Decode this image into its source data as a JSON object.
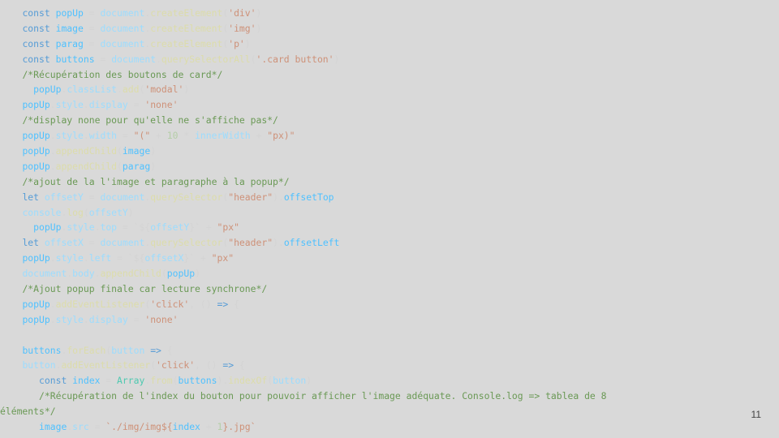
{
  "slide": {
    "page_number": "11"
  },
  "code_lines": [
    {
      "indent": "    ",
      "tokens": [
        {
          "t": "const ",
          "c": "kw"
        },
        {
          "t": "popUp",
          "c": "var"
        },
        {
          "t": " = ",
          "c": "op"
        },
        {
          "t": "document",
          "c": "prop"
        },
        {
          "t": ".",
          "c": "op"
        },
        {
          "t": "createElement",
          "c": "fn"
        },
        {
          "t": "(",
          "c": "op"
        },
        {
          "t": "'div'",
          "c": "str"
        },
        {
          "t": ")",
          "c": "op"
        }
      ]
    },
    {
      "indent": "    ",
      "tokens": [
        {
          "t": "const ",
          "c": "kw"
        },
        {
          "t": "image",
          "c": "var"
        },
        {
          "t": " = ",
          "c": "op"
        },
        {
          "t": "document",
          "c": "prop"
        },
        {
          "t": ".",
          "c": "op"
        },
        {
          "t": "createElement",
          "c": "fn"
        },
        {
          "t": "(",
          "c": "op"
        },
        {
          "t": "'img'",
          "c": "str"
        },
        {
          "t": ")",
          "c": "op"
        }
      ]
    },
    {
      "indent": "    ",
      "tokens": [
        {
          "t": "const ",
          "c": "kw"
        },
        {
          "t": "parag",
          "c": "var"
        },
        {
          "t": " = ",
          "c": "op"
        },
        {
          "t": "document",
          "c": "prop"
        },
        {
          "t": ".",
          "c": "op"
        },
        {
          "t": "createElement",
          "c": "fn"
        },
        {
          "t": "(",
          "c": "op"
        },
        {
          "t": "'p'",
          "c": "str"
        },
        {
          "t": ")",
          "c": "op"
        }
      ]
    },
    {
      "indent": "    ",
      "tokens": [
        {
          "t": "const ",
          "c": "kw"
        },
        {
          "t": "buttons",
          "c": "var"
        },
        {
          "t": " = ",
          "c": "op"
        },
        {
          "t": "document",
          "c": "prop"
        },
        {
          "t": ".",
          "c": "op"
        },
        {
          "t": "querySelectorAll",
          "c": "fn"
        },
        {
          "t": "(",
          "c": "op"
        },
        {
          "t": "'.card button'",
          "c": "str"
        },
        {
          "t": ")",
          "c": "op"
        }
      ]
    },
    {
      "indent": "    ",
      "tokens": [
        {
          "t": "/*Récupération des boutons de card*/",
          "c": "cm"
        }
      ]
    },
    {
      "indent": "      ",
      "tokens": [
        {
          "t": "popUp",
          "c": "var"
        },
        {
          "t": ".",
          "c": "op"
        },
        {
          "t": "classList",
          "c": "prop"
        },
        {
          "t": ".",
          "c": "op"
        },
        {
          "t": "add",
          "c": "fn"
        },
        {
          "t": "(",
          "c": "op"
        },
        {
          "t": "'modal'",
          "c": "str"
        },
        {
          "t": ")",
          "c": "op"
        }
      ]
    },
    {
      "indent": "    ",
      "tokens": [
        {
          "t": "popUp",
          "c": "var"
        },
        {
          "t": ".",
          "c": "op"
        },
        {
          "t": "style",
          "c": "prop"
        },
        {
          "t": ".",
          "c": "op"
        },
        {
          "t": "display",
          "c": "prop"
        },
        {
          "t": " = ",
          "c": "op"
        },
        {
          "t": "'none'",
          "c": "str"
        }
      ]
    },
    {
      "indent": "    ",
      "tokens": [
        {
          "t": "/*display none pour qu'elle ne s'affiche pas*/",
          "c": "cm"
        }
      ]
    },
    {
      "indent": "    ",
      "tokens": [
        {
          "t": "popUp",
          "c": "var"
        },
        {
          "t": ".",
          "c": "op"
        },
        {
          "t": "style",
          "c": "prop"
        },
        {
          "t": ".",
          "c": "op"
        },
        {
          "t": "width",
          "c": "prop"
        },
        {
          "t": " = ",
          "c": "op"
        },
        {
          "t": "\"(\"",
          "c": "str"
        },
        {
          "t": " + ",
          "c": "op"
        },
        {
          "t": "10",
          "c": "num"
        },
        {
          "t": " * ",
          "c": "op"
        },
        {
          "t": "innerWidth",
          "c": "prop"
        },
        {
          "t": " + ",
          "c": "op"
        },
        {
          "t": "\"px)\"",
          "c": "str"
        }
      ]
    },
    {
      "indent": "    ",
      "tokens": [
        {
          "t": "popUp",
          "c": "var"
        },
        {
          "t": ".",
          "c": "op"
        },
        {
          "t": "appendChild",
          "c": "fn"
        },
        {
          "t": "(",
          "c": "op"
        },
        {
          "t": "image",
          "c": "var"
        },
        {
          "t": ")",
          "c": "op"
        }
      ]
    },
    {
      "indent": "    ",
      "tokens": [
        {
          "t": "popUp",
          "c": "var"
        },
        {
          "t": ".",
          "c": "op"
        },
        {
          "t": "appendChild",
          "c": "fn"
        },
        {
          "t": "(",
          "c": "op"
        },
        {
          "t": "parag",
          "c": "var"
        },
        {
          "t": ")",
          "c": "op"
        }
      ]
    },
    {
      "indent": "    ",
      "tokens": [
        {
          "t": "/*ajout de la l'image et paragraphe à la popup*/",
          "c": "cm"
        }
      ]
    },
    {
      "indent": "    ",
      "tokens": [
        {
          "t": "let ",
          "c": "kw"
        },
        {
          "t": "offsetY",
          "c": "prop"
        },
        {
          "t": " = ",
          "c": "op"
        },
        {
          "t": "document",
          "c": "prop"
        },
        {
          "t": ".",
          "c": "op"
        },
        {
          "t": "querySelector",
          "c": "fn"
        },
        {
          "t": "(",
          "c": "op"
        },
        {
          "t": "\"header\"",
          "c": "str"
        },
        {
          "t": ").",
          "c": "op"
        },
        {
          "t": "offsetTop",
          "c": "var"
        }
      ]
    },
    {
      "indent": "    ",
      "tokens": [
        {
          "t": "console",
          "c": "prop"
        },
        {
          "t": ".",
          "c": "op"
        },
        {
          "t": "log",
          "c": "fn"
        },
        {
          "t": "(",
          "c": "op"
        },
        {
          "t": "offsetY",
          "c": "prop"
        },
        {
          "t": ")",
          "c": "op"
        }
      ]
    },
    {
      "indent": "      ",
      "tokens": [
        {
          "t": "popUp",
          "c": "var"
        },
        {
          "t": ".",
          "c": "op"
        },
        {
          "t": "style",
          "c": "prop"
        },
        {
          "t": ".",
          "c": "op"
        },
        {
          "t": "top",
          "c": "prop"
        },
        {
          "t": " = ",
          "c": "op"
        },
        {
          "t": "`${",
          "c": "tpl"
        },
        {
          "t": "offsetY",
          "c": "prop"
        },
        {
          "t": "}`",
          "c": "tpl"
        },
        {
          "t": " + ",
          "c": "op"
        },
        {
          "t": "\"px\"",
          "c": "str"
        }
      ]
    },
    {
      "indent": "    ",
      "tokens": [
        {
          "t": "let ",
          "c": "kw"
        },
        {
          "t": "offsetX",
          "c": "prop"
        },
        {
          "t": " = ",
          "c": "op"
        },
        {
          "t": "document",
          "c": "prop"
        },
        {
          "t": ".",
          "c": "op"
        },
        {
          "t": "querySelector",
          "c": "fn"
        },
        {
          "t": "(",
          "c": "op"
        },
        {
          "t": "\"header\"",
          "c": "str"
        },
        {
          "t": ").",
          "c": "op"
        },
        {
          "t": "offsetLeft",
          "c": "var"
        }
      ]
    },
    {
      "indent": "    ",
      "tokens": [
        {
          "t": "popUp",
          "c": "var"
        },
        {
          "t": ".",
          "c": "op"
        },
        {
          "t": "style",
          "c": "prop"
        },
        {
          "t": ".",
          "c": "op"
        },
        {
          "t": "left",
          "c": "prop"
        },
        {
          "t": " = ",
          "c": "op"
        },
        {
          "t": "`${",
          "c": "tpl"
        },
        {
          "t": "offsetX",
          "c": "prop"
        },
        {
          "t": "}`",
          "c": "tpl"
        },
        {
          "t": " + ",
          "c": "op"
        },
        {
          "t": "\"px\"",
          "c": "str"
        }
      ]
    },
    {
      "indent": "    ",
      "tokens": [
        {
          "t": "document",
          "c": "prop"
        },
        {
          "t": ".",
          "c": "op"
        },
        {
          "t": "body",
          "c": "prop"
        },
        {
          "t": ".",
          "c": "op"
        },
        {
          "t": "appendChild",
          "c": "fn"
        },
        {
          "t": "(",
          "c": "op"
        },
        {
          "t": "popUp",
          "c": "var"
        },
        {
          "t": ")",
          "c": "op"
        }
      ]
    },
    {
      "indent": "    ",
      "tokens": [
        {
          "t": "/*Ajout popup finale car lecture synchrone*/",
          "c": "cm"
        }
      ]
    },
    {
      "indent": "    ",
      "tokens": [
        {
          "t": "popUp",
          "c": "var"
        },
        {
          "t": ".",
          "c": "op"
        },
        {
          "t": "addEventListener",
          "c": "fn"
        },
        {
          "t": "(",
          "c": "op"
        },
        {
          "t": "'click'",
          "c": "str"
        },
        {
          "t": ", () ",
          "c": "op"
        },
        {
          "t": "=>",
          "c": "kw"
        },
        {
          "t": " {",
          "c": "op"
        }
      ]
    },
    {
      "indent": "    ",
      "tokens": [
        {
          "t": "popUp",
          "c": "var"
        },
        {
          "t": ".",
          "c": "op"
        },
        {
          "t": "style",
          "c": "prop"
        },
        {
          "t": ".",
          "c": "op"
        },
        {
          "t": "display",
          "c": "prop"
        },
        {
          "t": " = ",
          "c": "op"
        },
        {
          "t": "'none'",
          "c": "str"
        }
      ]
    },
    {
      "indent": "",
      "tokens": []
    },
    {
      "indent": "    ",
      "tokens": [
        {
          "t": "buttons",
          "c": "var"
        },
        {
          "t": ".",
          "c": "op"
        },
        {
          "t": "forEach",
          "c": "fn"
        },
        {
          "t": "(",
          "c": "op"
        },
        {
          "t": "button",
          "c": "prop"
        },
        {
          "t": " ",
          "c": "op"
        },
        {
          "t": "=>",
          "c": "kw"
        },
        {
          "t": " {",
          "c": "op"
        }
      ]
    },
    {
      "indent": "    ",
      "tokens": [
        {
          "t": "button",
          "c": "prop"
        },
        {
          "t": ".",
          "c": "op"
        },
        {
          "t": "addEventListener",
          "c": "fn"
        },
        {
          "t": "(",
          "c": "op"
        },
        {
          "t": "'click'",
          "c": "str"
        },
        {
          "t": ", () ",
          "c": "op"
        },
        {
          "t": "=>",
          "c": "kw"
        },
        {
          "t": " {",
          "c": "op"
        }
      ]
    },
    {
      "indent": "       ",
      "tokens": [
        {
          "t": "const ",
          "c": "kw"
        },
        {
          "t": "index",
          "c": "var"
        },
        {
          "t": " = ",
          "c": "op"
        },
        {
          "t": "Array",
          "c": "cls"
        },
        {
          "t": ".",
          "c": "op"
        },
        {
          "t": "from",
          "c": "fn"
        },
        {
          "t": "(",
          "c": "op"
        },
        {
          "t": "buttons",
          "c": "var"
        },
        {
          "t": ").",
          "c": "op"
        },
        {
          "t": "indexOf",
          "c": "fn"
        },
        {
          "t": "(",
          "c": "op"
        },
        {
          "t": "button",
          "c": "prop"
        },
        {
          "t": ")",
          "c": "op"
        }
      ]
    },
    {
      "indent": "       ",
      "tokens": [
        {
          "t": "/*Récupération de l'index du bouton pour pouvoir afficher l'image adéquate. Console.log => tablea de 8",
          "c": "cm"
        }
      ]
    },
    {
      "indent": "",
      "tokens": [
        {
          "t": "éléments*/",
          "c": "cm"
        }
      ]
    },
    {
      "indent": "       ",
      "tokens": [
        {
          "t": "image",
          "c": "var"
        },
        {
          "t": ".",
          "c": "op"
        },
        {
          "t": "src",
          "c": "prop"
        },
        {
          "t": " = ",
          "c": "op"
        },
        {
          "t": "`./img/img${",
          "c": "str"
        },
        {
          "t": "index",
          "c": "var"
        },
        {
          "t": " + ",
          "c": "op"
        },
        {
          "t": "1",
          "c": "num"
        },
        {
          "t": "}.jpg`",
          "c": "str"
        }
      ]
    }
  ]
}
